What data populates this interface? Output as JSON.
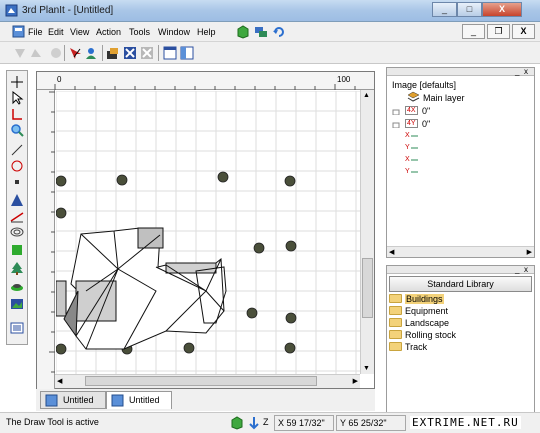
{
  "window": {
    "title": "3rd PlanIt - [Untitled]",
    "min": "_",
    "max": "□",
    "close": "X"
  },
  "menubar": {
    "items": [
      "File",
      "Edit",
      "View",
      "Action",
      "Tools",
      "Window",
      "Help"
    ],
    "mdi_min": "_",
    "mdi_restore": "❐",
    "mdi_close": "X"
  },
  "ruler": {
    "h_start": "0",
    "h_mark": "100"
  },
  "tabs": [
    "Untitled",
    "Untitled"
  ],
  "image_panel": {
    "title": "Image [defaults]",
    "main_layer": "Main layer",
    "rows": [
      {
        "tag": "4X",
        "value": "0\""
      },
      {
        "tag": "4Y",
        "value": "0\""
      }
    ],
    "axis_labels": [
      "X",
      "Y",
      "X",
      "Y"
    ]
  },
  "library_panel": {
    "button": "Standard Library",
    "items": [
      "Buildings",
      "Equipment",
      "Landscape",
      "Rolling stock",
      "Track"
    ],
    "selected": 0
  },
  "status": {
    "message": "The Draw Tool is active",
    "snap": "Z",
    "x": "X 59 17/32\"",
    "y": "Y 65 25/32\""
  },
  "watermark": "EXTRIME.NET.RU",
  "colors": {
    "node_fill": "#4a4f3a",
    "accent": "#2b6fcf",
    "grid": "#d8d8d8"
  }
}
